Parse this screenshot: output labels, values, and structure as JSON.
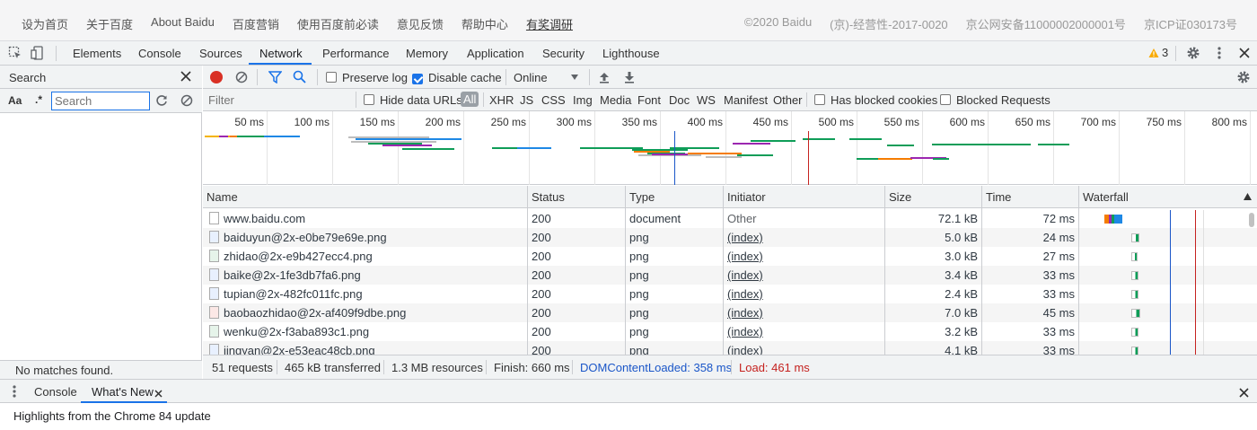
{
  "baidu_footer": {
    "links": [
      "设为首页",
      "关于百度",
      "About Baidu",
      "百度营销",
      "使用百度前必读",
      "意见反馈",
      "帮助中心",
      "有奖调研"
    ],
    "right": [
      "©2020 Baidu",
      "(京)-经营性-2017-0020",
      "京公网安备11000002000001号",
      "京ICP证030173号"
    ]
  },
  "devtools": {
    "tabs": [
      "Elements",
      "Console",
      "Sources",
      "Network",
      "Performance",
      "Memory",
      "Application",
      "Security",
      "Lighthouse"
    ],
    "active_tab": "Network",
    "warning_count": "3"
  },
  "search_panel": {
    "title": "Search",
    "case_label": "Aa",
    "regex_label": ".*",
    "placeholder": "Search",
    "no_matches": "No matches found."
  },
  "network_toolbar": {
    "preserve_log": "Preserve log",
    "disable_cache": "Disable cache",
    "throttling": "Online"
  },
  "filter_bar": {
    "placeholder": "Filter",
    "hide_data_urls": "Hide data URLs",
    "types": [
      "All",
      "XHR",
      "JS",
      "CSS",
      "Img",
      "Media",
      "Font",
      "Doc",
      "WS",
      "Manifest",
      "Other"
    ],
    "has_blocked_cookies": "Has blocked cookies",
    "blocked_requests": "Blocked Requests"
  },
  "overview": {
    "ticks": [
      "50 ms",
      "100 ms",
      "150 ms",
      "200 ms",
      "250 ms",
      "300 ms",
      "350 ms",
      "400 ms",
      "450 ms",
      "500 ms",
      "550 ms",
      "600 ms",
      "650 ms",
      "700 ms",
      "750 ms",
      "800 ms"
    ]
  },
  "table": {
    "columns": [
      "Name",
      "Status",
      "Type",
      "Initiator",
      "Size",
      "Time",
      "Waterfall"
    ],
    "rows": [
      {
        "name": "www.baidu.com",
        "status": "200",
        "type": "document",
        "initiator": "Other",
        "size": "72.1 kB",
        "time": "72 ms"
      },
      {
        "name": "baiduyun@2x-e0be79e69e.png",
        "status": "200",
        "type": "png",
        "initiator": "(index)",
        "size": "5.0 kB",
        "time": "24 ms"
      },
      {
        "name": "zhidao@2x-e9b427ecc4.png",
        "status": "200",
        "type": "png",
        "initiator": "(index)",
        "size": "3.0 kB",
        "time": "27 ms"
      },
      {
        "name": "baike@2x-1fe3db7fa6.png",
        "status": "200",
        "type": "png",
        "initiator": "(index)",
        "size": "3.4 kB",
        "time": "33 ms"
      },
      {
        "name": "tupian@2x-482fc011fc.png",
        "status": "200",
        "type": "png",
        "initiator": "(index)",
        "size": "2.4 kB",
        "time": "33 ms"
      },
      {
        "name": "baobaozhidao@2x-af409f9dbe.png",
        "status": "200",
        "type": "png",
        "initiator": "(index)",
        "size": "7.0 kB",
        "time": "45 ms"
      },
      {
        "name": "wenku@2x-f3aba893c1.png",
        "status": "200",
        "type": "png",
        "initiator": "(index)",
        "size": "3.2 kB",
        "time": "33 ms"
      },
      {
        "name": "jingyan@2x-e53eac48cb.png",
        "status": "200",
        "type": "png",
        "initiator": "(index)",
        "size": "4.1 kB",
        "time": "33 ms"
      }
    ]
  },
  "status_bar": {
    "requests": "51 requests",
    "transferred": "465 kB transferred",
    "resources": "1.3 MB resources",
    "finish": "Finish: 660 ms",
    "dom_content_loaded": "DOMContentLoaded: 358 ms",
    "load": "Load: 461 ms"
  },
  "drawer": {
    "tabs": [
      "Console",
      "What's New"
    ],
    "active_tab": "What's New",
    "body": "Highlights from the Chrome 84 update"
  },
  "colors": {
    "accent": "#1a73e8",
    "record": "#d93025",
    "dom_content_loaded": "#1a56c8",
    "load": "#c5221f"
  }
}
